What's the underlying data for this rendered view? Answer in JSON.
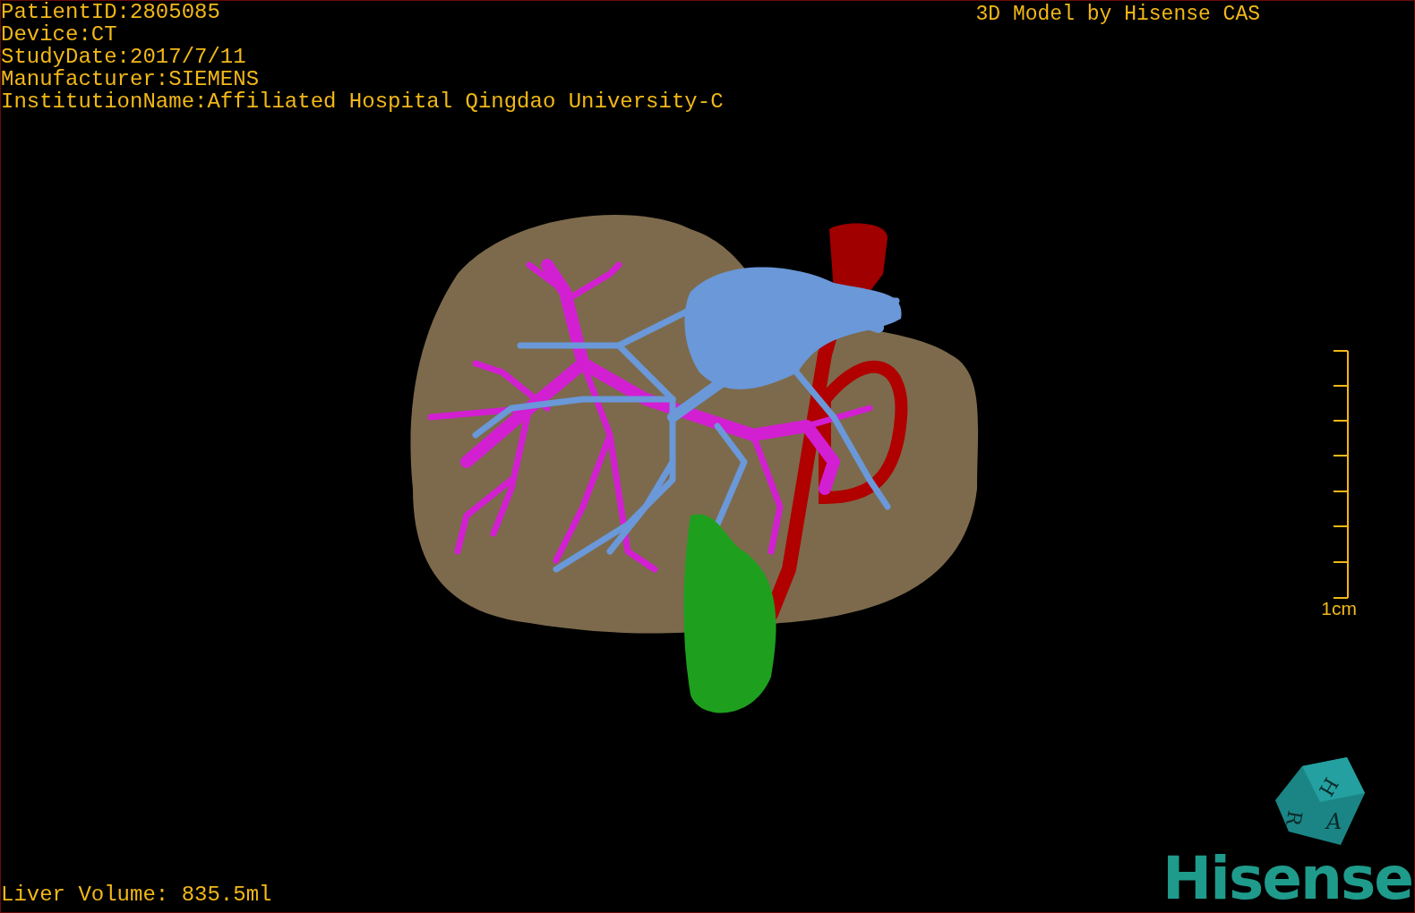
{
  "patient_info": [
    "PatientID:2805085",
    "Device:CT",
    "StudyDate:2017/7/11",
    "Manufacturer:SIEMENS",
    "InstitutionName:Affiliated Hospital Qingdao University-C"
  ],
  "title": "3D Model by Hisense CAS",
  "scale_bar": {
    "label": "1cm"
  },
  "volume": "Liver Volume: 835.5ml",
  "orientation_cube": {
    "faces": [
      "H",
      "R",
      "A"
    ]
  },
  "logo": "Hisense"
}
